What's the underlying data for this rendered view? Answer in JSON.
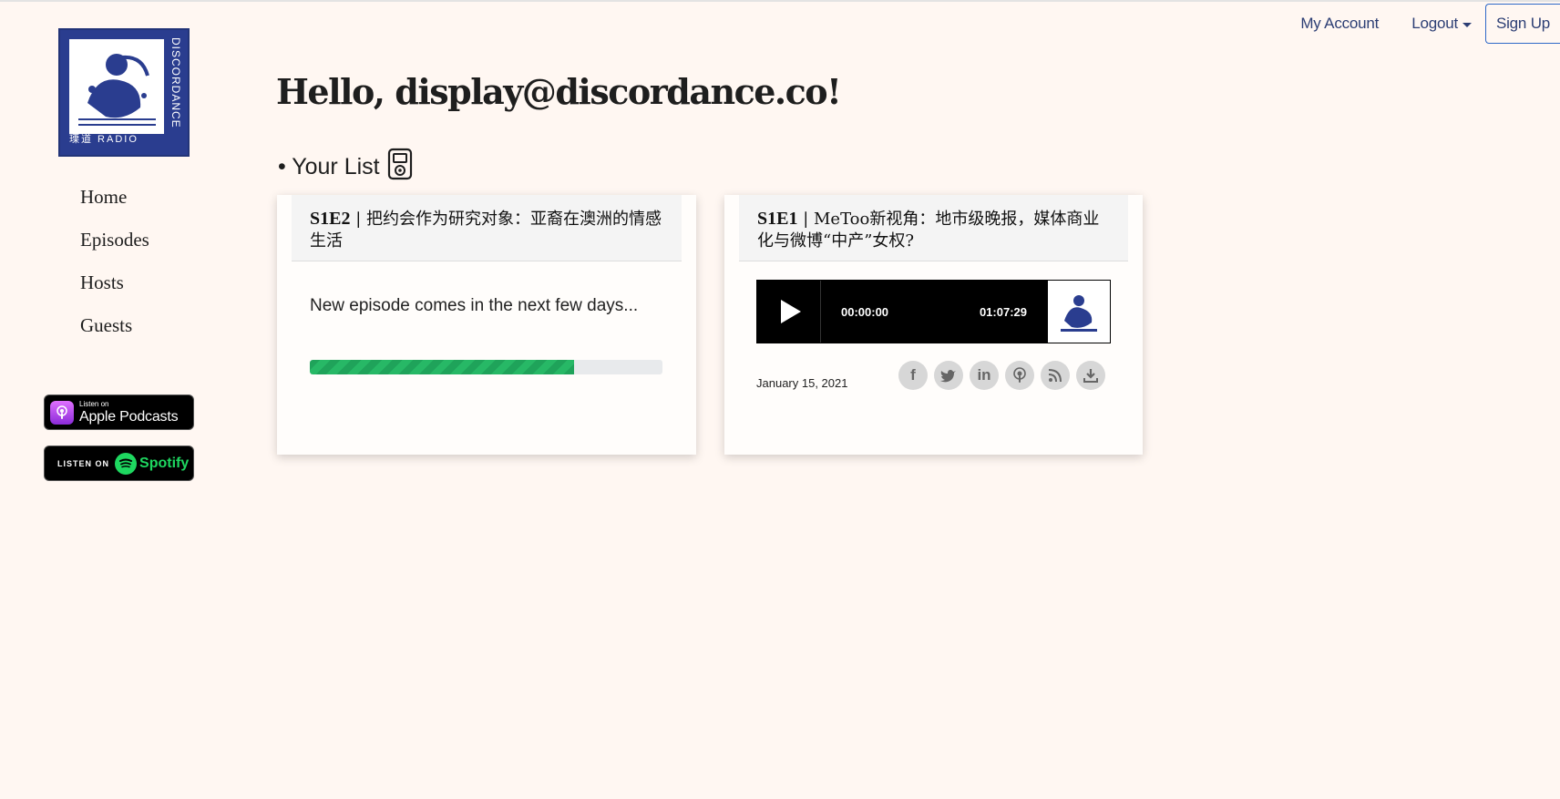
{
  "nav": {
    "account": "My Account",
    "logout": "Logout",
    "signup": "Sign Up"
  },
  "logo": {
    "vertical_text": "DISCORDANCE",
    "bottom_text": "瑮道 RADIO",
    "colors": {
      "background": "#2a3d8f",
      "text": "#ffffff"
    }
  },
  "sidebar": {
    "items": [
      {
        "label": "Home"
      },
      {
        "label": "Episodes"
      },
      {
        "label": "Hosts"
      },
      {
        "label": "Guests"
      }
    ]
  },
  "badges": {
    "apple_small": "Listen on",
    "apple_big": "Apple Podcasts",
    "spotify_listen": "LISTEN ON",
    "spotify_word": "Spotify"
  },
  "main": {
    "greeting": "Hello, display@discordance.co!",
    "list_title": "• Your List"
  },
  "cards": [
    {
      "code": "S1E2",
      "separator": " | ",
      "title": "把约会作为研究对象：亚裔在澳洲的情感生活",
      "status_text": "New episode comes in the next few days...",
      "progress": 0.75,
      "progress_color": "#1fa35a"
    },
    {
      "code": "S1E1",
      "separator": " | ",
      "title": "MeToo新视角：地市级晚报，媒体商业化与微博“中产”女权?",
      "player": {
        "current_time": "00:00:00",
        "duration": "01:07:29"
      },
      "date": "January 15, 2021",
      "share_icons": [
        "facebook-icon",
        "twitter-icon",
        "linkedin-icon",
        "podcast-icon",
        "rss-icon",
        "download-icon"
      ]
    }
  ]
}
